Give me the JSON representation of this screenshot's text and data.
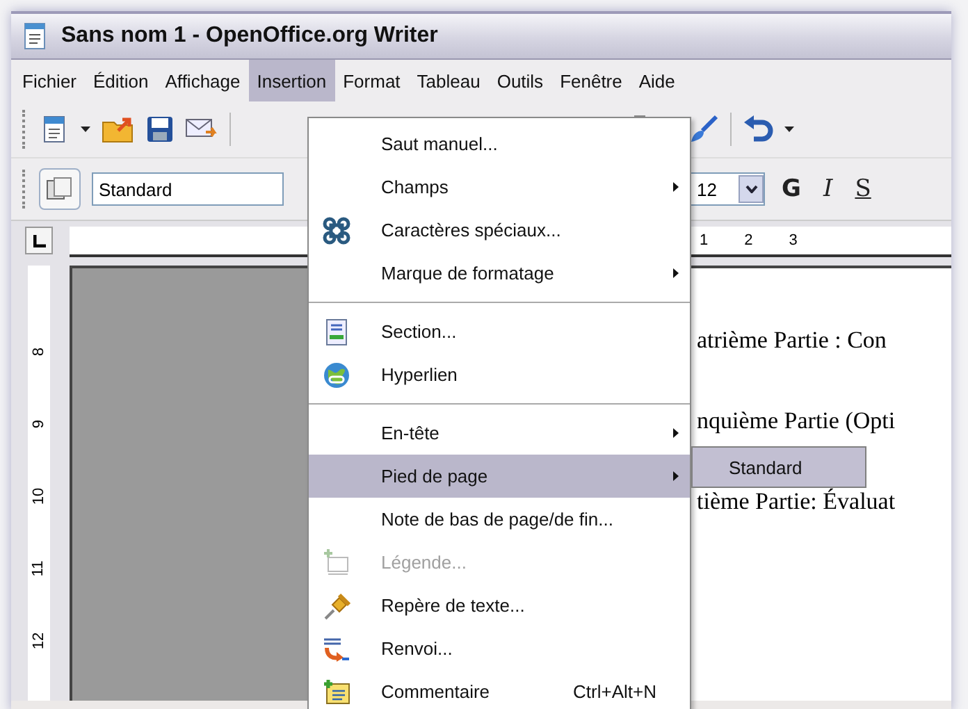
{
  "window": {
    "title": "Sans nom 1 - OpenOffice.org Writer"
  },
  "menu_bar": [
    {
      "label": "Fichier",
      "selected": false
    },
    {
      "label": "Édition",
      "selected": false
    },
    {
      "label": "Affichage",
      "selected": false
    },
    {
      "label": "Insertion",
      "selected": true
    },
    {
      "label": "Format",
      "selected": false
    },
    {
      "label": "Tableau",
      "selected": false
    },
    {
      "label": "Outils",
      "selected": false
    },
    {
      "label": "Fenêtre",
      "selected": false
    },
    {
      "label": "Aide",
      "selected": false
    }
  ],
  "formatting_toolbar": {
    "paragraph_style": "Standard",
    "font_size": "12",
    "bold": "G",
    "italic": "I",
    "underline": "S"
  },
  "horizontal_ruler": [
    "1",
    "2",
    "3"
  ],
  "vertical_ruler": [
    "8",
    "9",
    "10",
    "11",
    "12"
  ],
  "document": {
    "lines": [
      "atrième Partie : Con",
      "nquième Partie (Opti",
      "tième Partie: Évaluat"
    ]
  },
  "insert_menu": {
    "items": [
      {
        "kind": "command",
        "label": "Saut manuel...",
        "selected": false,
        "disabled": false
      },
      {
        "kind": "submenu",
        "label": "Champs",
        "selected": false,
        "disabled": false
      },
      {
        "kind": "command",
        "label": "Caractères spéciaux...",
        "selected": false,
        "disabled": false
      },
      {
        "kind": "submenu",
        "label": "Marque de formatage",
        "selected": false,
        "disabled": false
      },
      {
        "kind": "separator"
      },
      {
        "kind": "command",
        "label": "Section...",
        "selected": false,
        "disabled": false
      },
      {
        "kind": "command",
        "label": "Hyperlien",
        "selected": false,
        "disabled": false
      },
      {
        "kind": "separator"
      },
      {
        "kind": "submenu",
        "label": "En-tête",
        "selected": false,
        "disabled": false
      },
      {
        "kind": "submenu",
        "label": "Pied de page",
        "selected": true,
        "disabled": false
      },
      {
        "kind": "command",
        "label": "Note de bas de page/de fin...",
        "selected": false,
        "disabled": false
      },
      {
        "kind": "command",
        "label": "Légende...",
        "selected": false,
        "disabled": true
      },
      {
        "kind": "command",
        "label": "Repère de texte...",
        "selected": false,
        "disabled": false
      },
      {
        "kind": "command",
        "label": "Renvoi...",
        "selected": false,
        "disabled": false
      },
      {
        "kind": "command",
        "label": "Commentaire",
        "shortcut": "Ctrl+Alt+N",
        "selected": false,
        "disabled": false
      }
    ]
  },
  "submenu": {
    "items": [
      {
        "label": "Standard",
        "selected": false
      }
    ]
  }
}
